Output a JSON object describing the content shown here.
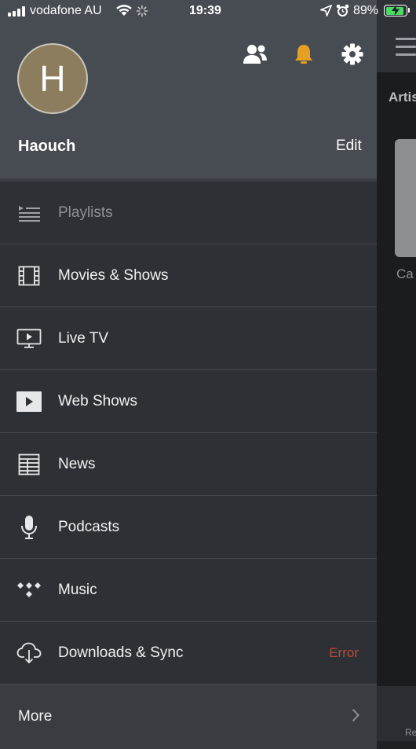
{
  "status_bar": {
    "carrier": "vodafone AU",
    "time": "19:39",
    "battery_percent": "89%",
    "battery_level": 0.89,
    "icons": [
      "signal-icon",
      "wifi-icon",
      "activity-spinner-icon",
      "location-arrow-icon",
      "alarm-clock-icon",
      "battery-charging-icon"
    ]
  },
  "profile": {
    "avatar_initial": "H",
    "username": "Haouch",
    "edit_label": "Edit",
    "icons": [
      "users-icon",
      "bell-icon",
      "gear-icon"
    ]
  },
  "menu": {
    "items": [
      {
        "label": "Playlists",
        "icon": "playlist-icon",
        "dimmed": true
      },
      {
        "label": "Movies & Shows",
        "icon": "film-icon"
      },
      {
        "label": "Live TV",
        "icon": "tv-icon"
      },
      {
        "label": "Web Shows",
        "icon": "play-box-icon"
      },
      {
        "label": "News",
        "icon": "newspaper-icon"
      },
      {
        "label": "Podcasts",
        "icon": "microphone-icon"
      },
      {
        "label": "Music",
        "icon": "tidal-icon"
      },
      {
        "label": "Downloads & Sync",
        "icon": "cloud-download-icon",
        "status": "Error"
      }
    ],
    "more_label": "More"
  },
  "background": {
    "tab_label": "Artis",
    "card_label": "Ca",
    "footer_label": "Re"
  },
  "colors": {
    "accent_bell": "#e5a024",
    "error": "#b94a3a",
    "battery_fill": "#4cd964"
  }
}
